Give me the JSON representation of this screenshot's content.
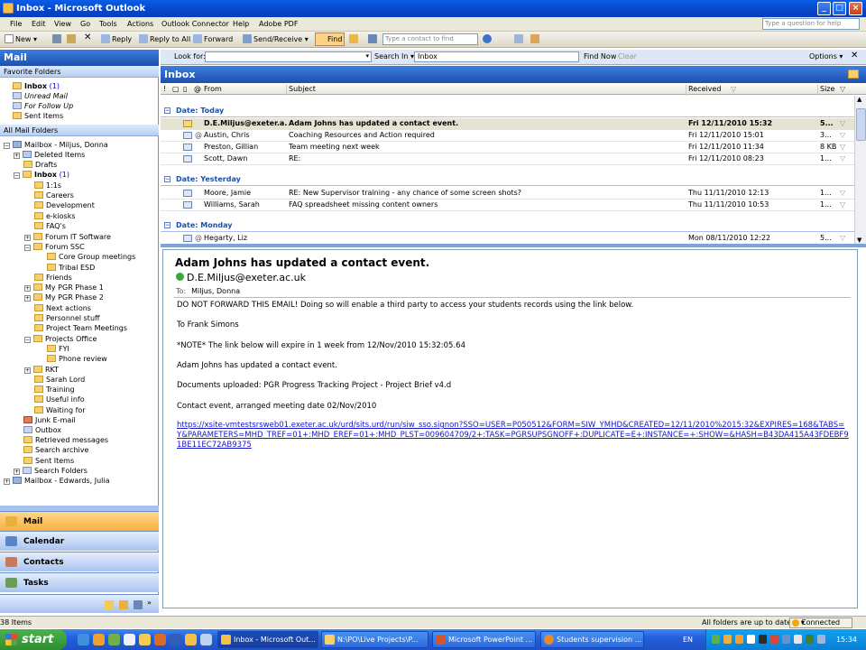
{
  "window": {
    "title": "Inbox - Microsoft Outlook",
    "controls": [
      "_",
      "□",
      "×"
    ]
  },
  "menubar": {
    "items": [
      "File",
      "Edit",
      "View",
      "Go",
      "Tools",
      "Actions",
      "Outlook Connector",
      "Help",
      "Adobe PDF"
    ],
    "help_placeholder": "Type a question for help"
  },
  "toolbar": {
    "new_label": "New",
    "reply_label": "Reply",
    "reply_all_label": "Reply to All",
    "forward_label": "Forward",
    "send_receive_label": "Send/Receive",
    "find_label": "Find",
    "contact_placeholder": "Type a contact to find"
  },
  "left": {
    "header": "Mail",
    "favorites_title": "Favorite Folders",
    "favorites": [
      {
        "label": "Inbox",
        "count": "(1)"
      },
      {
        "label": "Unread Mail"
      },
      {
        "label": "For Follow Up"
      },
      {
        "label": "Sent Items"
      }
    ],
    "all_folders_title": "All Mail Folders",
    "tree": [
      "Mailbox - Miljus, Donna",
      "Deleted Items",
      "Drafts",
      "Inbox",
      "1:1s",
      "Careers",
      "Development",
      "e-kiosks",
      "FAQ's",
      "Forum IT Software",
      "Forum SSC",
      "Core Group meetings",
      "Tribal ESD",
      "Friends",
      "My PGR Phase 1",
      "My PGR Phase 2",
      "Next actions",
      "Personnel stuff",
      "Project Team Meetings",
      "Projects Office",
      "FYI",
      "Phone review",
      "RKT",
      "Sarah Lord",
      "Training",
      "Useful info",
      "Waiting for",
      "Junk E-mail",
      "Outbox",
      "Retrieved messages",
      "Search archive",
      "Sent Items",
      "Search Folders",
      "Mailbox - Edwards, Julia"
    ],
    "inbox_count": "(1)",
    "nav": [
      "Mail",
      "Calendar",
      "Contacts",
      "Tasks"
    ]
  },
  "search": {
    "look_for_label": "Look for:",
    "search_in_label": "Search In",
    "search_in_value": "Inbox",
    "find_now": "Find Now",
    "clear": "Clear",
    "options": "Options"
  },
  "list": {
    "title": "Inbox",
    "columns": {
      "from": "From",
      "subject": "Subject",
      "received": "Received",
      "size": "Size"
    },
    "groups": [
      {
        "label": "Date: Today"
      },
      {
        "label": "Date: Yesterday"
      },
      {
        "label": "Date: Monday"
      }
    ],
    "rows": [
      {
        "from": "D.E.Miljus@exeter.a...",
        "subject": "Adam Johns has updated a contact event.",
        "received": "Fri 12/11/2010 15:32",
        "size": "5..."
      },
      {
        "from": "Austin, Chris",
        "subject": "Coaching Resources and Action required",
        "received": "Fri 12/11/2010 15:01",
        "size": "3..."
      },
      {
        "from": "Preston, Gillian",
        "subject": "Team meeting next week",
        "received": "Fri 12/11/2010 11:34",
        "size": "8 KB"
      },
      {
        "from": "Scott, Dawn",
        "subject": "RE:",
        "received": "Fri 12/11/2010 08:23",
        "size": "1..."
      },
      {
        "from": "Moore, Jamie",
        "subject": "RE: New Supervisor training - any chance of some screen shots?",
        "received": "Thu 11/11/2010 12:13",
        "size": "1..."
      },
      {
        "from": "Williams, Sarah",
        "subject": "FAQ spreadsheet missing content owners",
        "received": "Thu 11/11/2010 10:53",
        "size": "1..."
      },
      {
        "from": "Hegarty, Liz",
        "subject": "",
        "received": "Mon 08/11/2010 12:22",
        "size": "5..."
      }
    ]
  },
  "reading": {
    "subject": "Adam Johns has updated a contact event.",
    "from": "D.E.Miljus@exeter.ac.uk",
    "to_label": "To:",
    "to": "Miljus, Donna",
    "body": [
      "DO NOT FORWARD THIS EMAIL!  Doing so will enable a third party to access your students records using the link below.",
      "To Frank Simons",
      "*NOTE* The link below will expire in 1 week from 12/Nov/2010 15:32:05.64",
      "Adam Johns has updated a contact event.",
      "Documents uploaded:  PGR Progress Tracking Project - Project Brief v4.d",
      "Contact event, arranged meeting date 02/Nov/2010"
    ],
    "link": "https://xsite-vmtestsrsweb01.exeter.ac.uk/urd/sits.urd/run/siw_sso.signon?SSO=USER=P050512&FORM=SIW_YMHD&CREATED=12/11/2010%2015:32&EXPIRES=168&TABS=Y&PARAMETERS=MHD_TREF=01+:MHD_EREF=01+:MHD_PLST=009604709/2+:TASK=PGRSUPSGNOFF+:DUPLICATE=E+:INSTANCE=+:SHOW=&HASH=B43DA415A43FDEBF91BE11EC72AB9375"
  },
  "status": {
    "items": "38 Items",
    "sync": "All folders are up to date.",
    "connection": "Connected"
  },
  "taskbar": {
    "start": "start",
    "tasks": [
      "Inbox - Microsoft Out...",
      "N:\\PO\\Live Projects\\P...",
      "Microsoft PowerPoint ...",
      "Students supervision ..."
    ],
    "lang": "EN",
    "clock": "15:34"
  },
  "colors": {
    "accent": "#1e4fae",
    "selected_nav": "#f8b03e",
    "link": "#1515c9",
    "taskbar": "#245edb"
  }
}
